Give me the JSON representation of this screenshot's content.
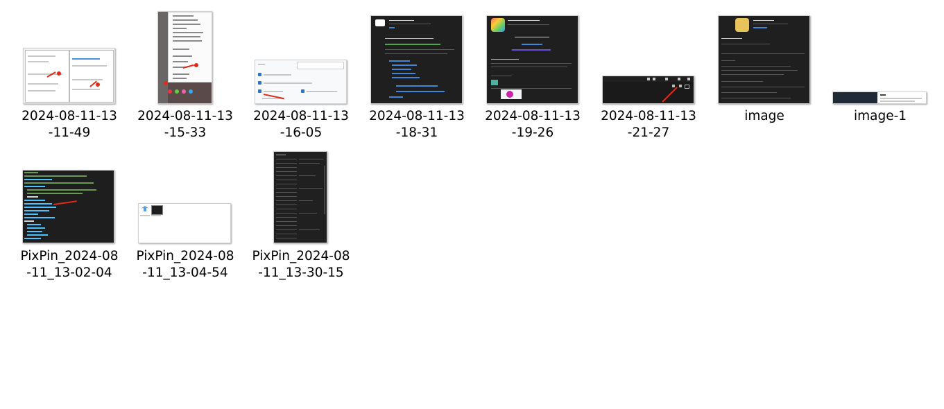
{
  "files": [
    {
      "line1": "2024-08-11-13",
      "line2": "-11-49",
      "icon": "screenshot-thumbnail-light-settings"
    },
    {
      "line1": "2024-08-11-13",
      "line2": "-15-33",
      "icon": "screenshot-thumbnail-context-menu"
    },
    {
      "line1": "2024-08-11-13",
      "line2": "-16-05",
      "icon": "screenshot-thumbnail-options-panel"
    },
    {
      "line1": "2024-08-11-13",
      "line2": "-18-31",
      "icon": "screenshot-thumbnail-markdown-extension"
    },
    {
      "line1": "2024-08-11-13",
      "line2": "-19-26",
      "icon": "screenshot-thumbnail-markdown-preview"
    },
    {
      "line1": "2024-08-11-13",
      "line2": "-21-27",
      "icon": "screenshot-thumbnail-toolbar"
    },
    {
      "line1": "image",
      "line2": "",
      "icon": "screenshot-thumbnail-extension-page"
    },
    {
      "line1": "image-1",
      "line2": "",
      "icon": "screenshot-thumbnail-banner"
    },
    {
      "line1": "PixPin_2024-08",
      "line2": "-11_13-02-04",
      "icon": "screenshot-thumbnail-code"
    },
    {
      "line1": "PixPin_2024-08",
      "line2": "-11_13-04-54",
      "icon": "screenshot-thumbnail-desktop"
    },
    {
      "line1": "PixPin_2024-08",
      "line2": "-11_13-30-15",
      "icon": "screenshot-thumbnail-dark-settings"
    }
  ],
  "colors": {
    "background": "#ffffff",
    "accent_red": "#e02a1a",
    "dark": "#1f1f1f",
    "link_blue": "#3f86d6"
  }
}
